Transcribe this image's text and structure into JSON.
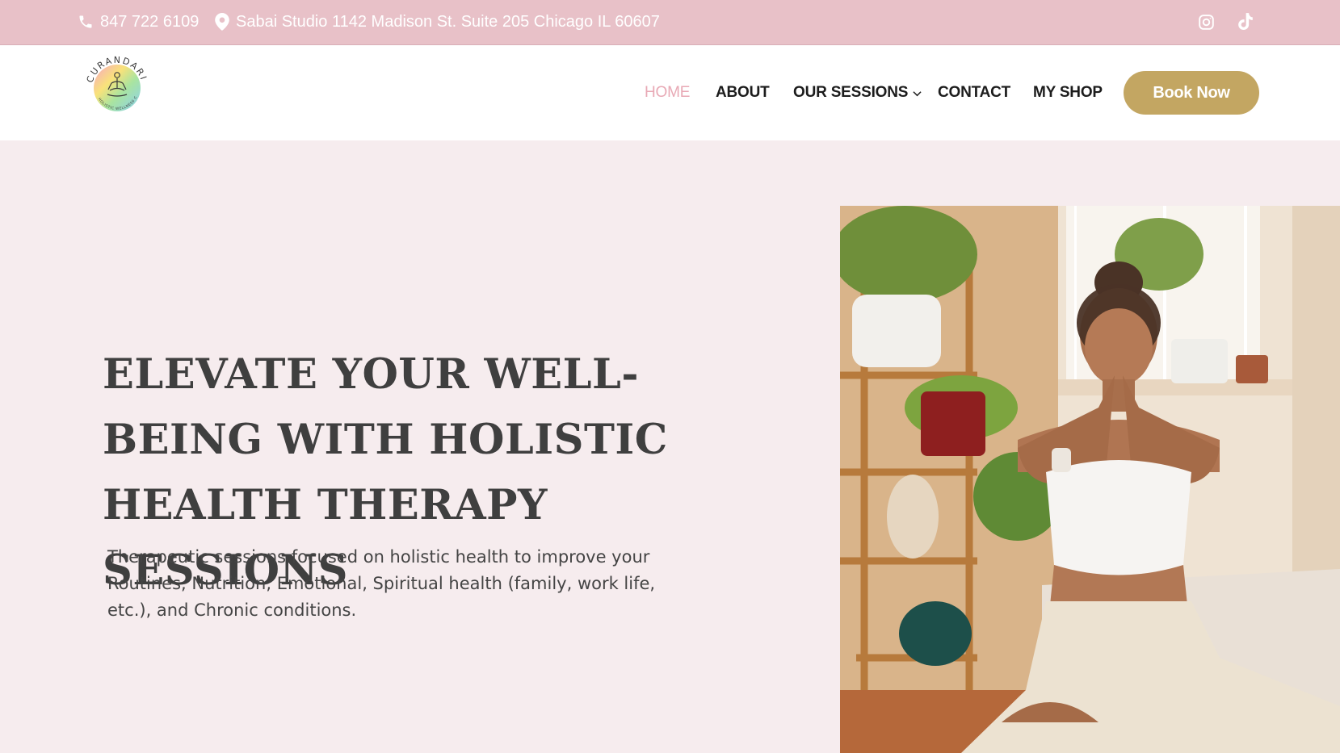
{
  "topbar": {
    "phone": "847 722 6109",
    "address": "Sabai Studio 1142 Madison St. Suite 205 Chicago IL 60607",
    "icons": [
      "phone-icon",
      "map-pin-icon",
      "instagram-icon",
      "tiktok-icon"
    ]
  },
  "header": {
    "logo_text": "CURANDARI",
    "logo_subtext": "HOLISTIC WELLNESS COACH",
    "nav": {
      "home": "HOME",
      "about": "ABOUT",
      "sessions": "OUR SESSIONS",
      "contact": "CONTACT",
      "shop": "MY SHOP"
    },
    "book_label": "Book Now"
  },
  "hero": {
    "headline": "ELEVATE YOUR WELL-BEING WITH HOLISTIC HEALTH THERAPY SESSIONS",
    "subtext": "Therapeutic sessions focused on holistic health to improve your Routines, Nutrition, Emotional, Spiritual health (family, work life, etc.), and Chronic conditions."
  },
  "colors": {
    "topbar": "#e8c1c8",
    "nav_active": "#e8a9b5",
    "button": "#c3a662",
    "hero_bg": "#f6ecee",
    "headline": "#3f3f3f"
  }
}
